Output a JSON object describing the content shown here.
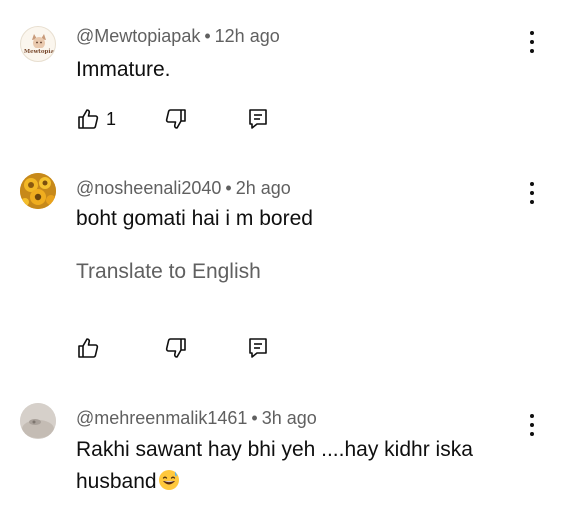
{
  "comments": [
    {
      "author": "@Mewtopiapak",
      "time": "12h ago",
      "text": "Immature.",
      "likes": "1",
      "avatar_text": "Mewtopia",
      "avatar_icon": "mewtopia-logo-icon"
    },
    {
      "author": "@nosheenali2040",
      "time": "2h ago",
      "text": "boht gomati hai i m bored",
      "translate": "Translate to English",
      "likes": "",
      "avatar_icon": "sunflower-avatar-icon"
    },
    {
      "author": "@mehreenmalik1461",
      "time": "3h ago",
      "text_line1": "Rakhi sawant hay bhi yeh ....hay kidhr iska",
      "text_line2": "husband",
      "emoji": "grinning-sweat-emoji",
      "avatar_icon": "photo-avatar-icon"
    }
  ],
  "separator": "•",
  "colors": {
    "text": "#0f0f0f",
    "secondary": "#606060",
    "background": "#ffffff"
  }
}
